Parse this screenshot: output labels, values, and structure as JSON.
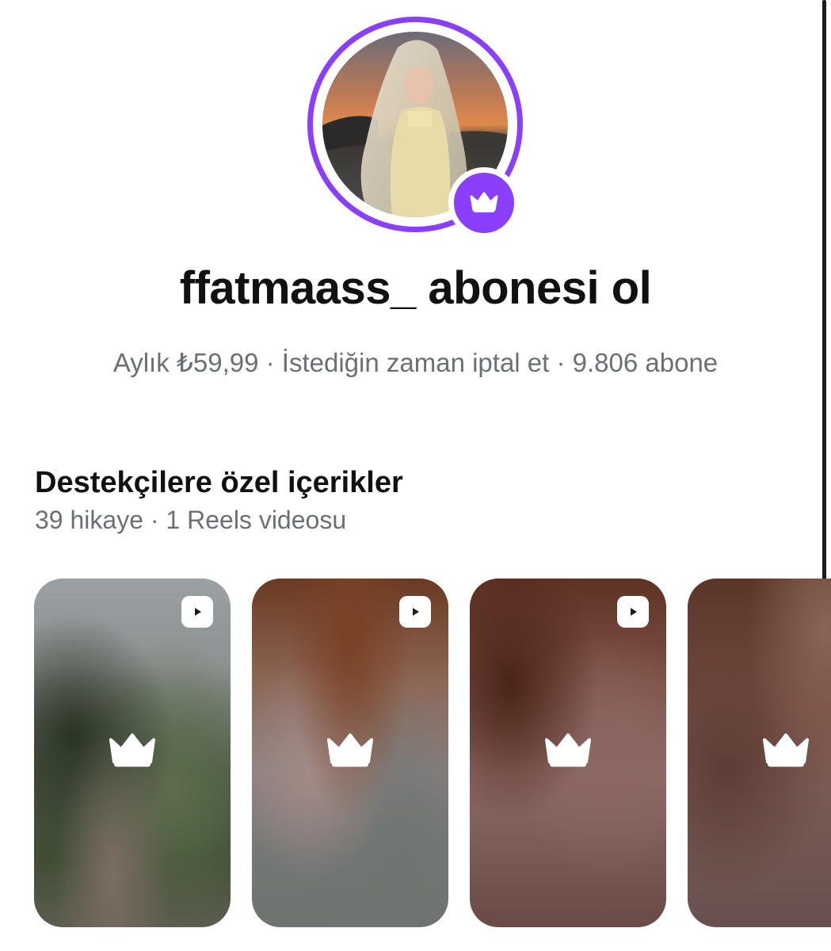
{
  "profile": {
    "username": "ffatmaass_",
    "avatar_alt": "profile-photo",
    "badge_icon": "crown-icon",
    "accent_color": "#8a3ffc"
  },
  "header": {
    "title": "ffatmaass_ abonesi ol",
    "subtitle": "Aylık ₺59,99 · İstediğin zaman iptal et · 9.806 abone"
  },
  "section": {
    "title": "Destekçilere özel içerikler",
    "subtitle": "39 hikaye · 1 Reels videosu"
  },
  "cards": [
    {
      "type": "video",
      "locked": true,
      "icon": "play-icon"
    },
    {
      "type": "video",
      "locked": true,
      "icon": "play-icon"
    },
    {
      "type": "video",
      "locked": true,
      "icon": "play-icon"
    },
    {
      "type": "story",
      "locked": true
    }
  ]
}
